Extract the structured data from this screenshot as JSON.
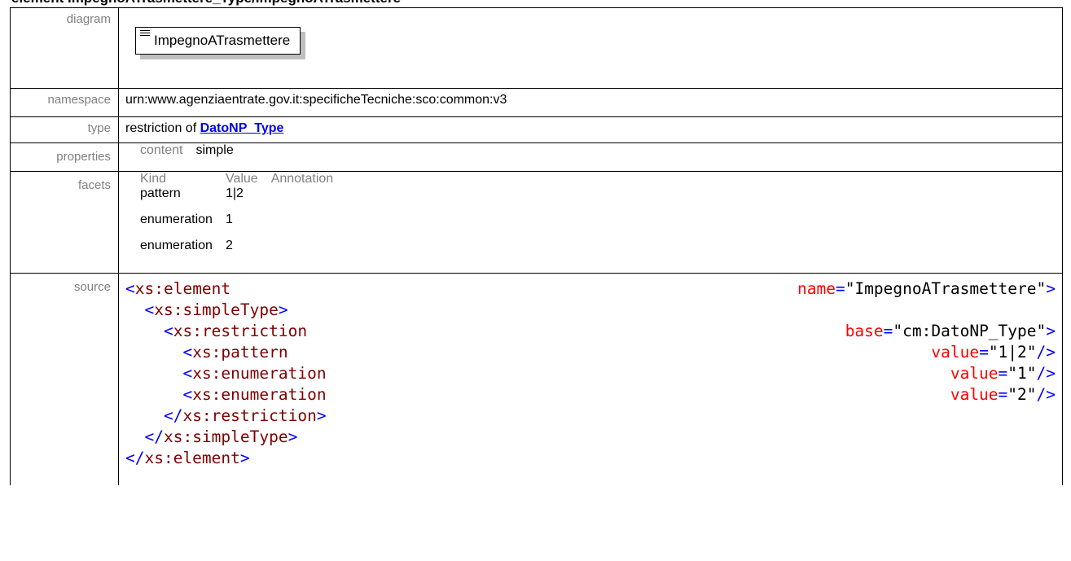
{
  "title": "element ImpegnoATrasmettere_Type/ImpegnoATrasmettere",
  "labels": {
    "diagram": "diagram",
    "namespace": "namespace",
    "type": "type",
    "properties": "properties",
    "facets": "facets",
    "source": "source"
  },
  "diagram": {
    "element_name": "ImpegnoATrasmettere",
    "icon": "sequence-lines-icon"
  },
  "namespace": "urn:www.agenziaentrate.gov.it:specificheTecniche:sco:common:v3",
  "type": {
    "prefix": "restriction of ",
    "link": "DatoNP_Type"
  },
  "properties": {
    "key": "content",
    "value": "simple"
  },
  "facets": {
    "headers": [
      "Kind",
      "Value",
      "Annotation"
    ],
    "rows": [
      {
        "kind": "pattern",
        "value": "1|2",
        "annotation": ""
      },
      {
        "kind": "enumeration",
        "value": "1",
        "annotation": ""
      },
      {
        "kind": "enumeration",
        "value": "2",
        "annotation": ""
      }
    ]
  },
  "source": {
    "lines": [
      {
        "indent": "",
        "open": "<",
        "name": "xs:element",
        "attr": "name",
        "val": "\"ImpegnoATrasmettere\"",
        "close": ">"
      },
      {
        "indent": "  ",
        "open": "<",
        "name": "xs:simpleType",
        "close": ">"
      },
      {
        "indent": "    ",
        "open": "<",
        "name": "xs:restriction",
        "attr": "base",
        "val": "\"cm:DatoNP_Type\"",
        "close": ">"
      },
      {
        "indent": "      ",
        "open": "<",
        "name": "xs:pattern",
        "attr": "value",
        "val": "\"1|2\"",
        "close": "/>"
      },
      {
        "indent": "      ",
        "open": "<",
        "name": "xs:enumeration",
        "attr": "value",
        "val": "\"1\"",
        "close": "/>"
      },
      {
        "indent": "      ",
        "open": "<",
        "name": "xs:enumeration",
        "attr": "value",
        "val": "\"2\"",
        "close": "/>"
      },
      {
        "indent": "    ",
        "open": "</",
        "name": "xs:restriction",
        "close": ">"
      },
      {
        "indent": "  ",
        "open": "</",
        "name": "xs:simpleType",
        "close": ">"
      },
      {
        "indent": "",
        "open": "</",
        "name": "xs:element",
        "close": ">"
      }
    ]
  }
}
